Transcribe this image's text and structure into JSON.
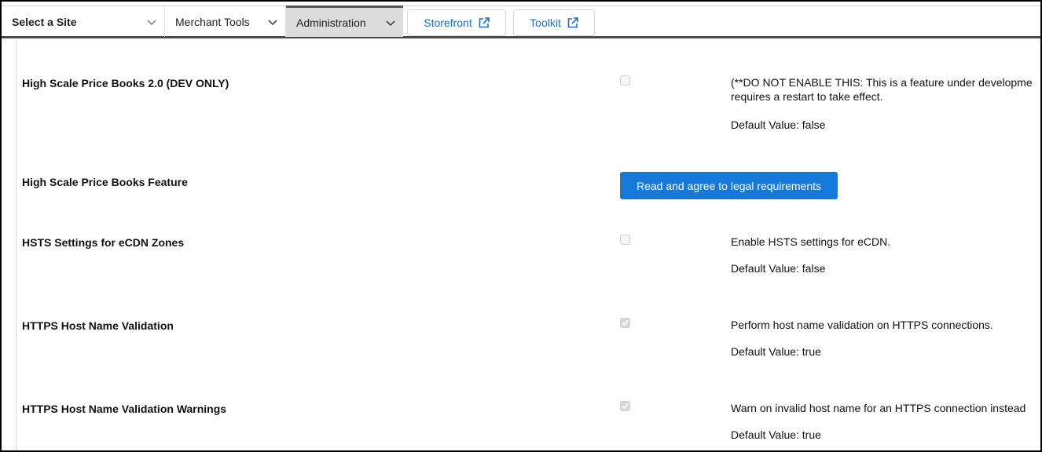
{
  "nav": {
    "site_select": {
      "label": "Select a Site",
      "icon": "chevron-down-icon"
    },
    "merchant_tools": {
      "label": "Merchant Tools",
      "icon": "chevron-down-icon"
    },
    "administration": {
      "label": "Administration",
      "icon": "chevron-down-icon",
      "active": true
    },
    "storefront": {
      "label": "Storefront",
      "icon": "external-link-icon"
    },
    "toolkit": {
      "label": "Toolkit",
      "icon": "external-link-icon"
    }
  },
  "colors": {
    "link": "#1a6fc8",
    "primary_button": "#1479d8",
    "active_tab_bg": "#dcdcdc",
    "nav_border": "#4a4a4a"
  },
  "preferences": [
    {
      "name": "High Scale Price Books 2.0 (DEV ONLY)",
      "control": "checkbox",
      "checked": false,
      "description_lines": [
        "(**DO NOT ENABLE THIS: This is a feature under developme",
        "requires a restart to take effect."
      ],
      "default_value": "Default Value: false"
    },
    {
      "name": "High Scale Price Books Feature",
      "control": "button",
      "button_label": "Read and agree to legal requirements"
    },
    {
      "name": "HSTS Settings for eCDN Zones",
      "control": "checkbox",
      "checked": false,
      "description_lines": [
        "Enable HSTS settings for eCDN."
      ],
      "default_value": "Default Value: false"
    },
    {
      "name": "HTTPS Host Name Validation",
      "control": "checkbox",
      "checked": true,
      "description_lines": [
        "Perform host name validation on HTTPS connections."
      ],
      "default_value": "Default Value: true"
    },
    {
      "name": "HTTPS Host Name Validation Warnings",
      "control": "checkbox",
      "checked": true,
      "description_lines": [
        "Warn on invalid host name for an HTTPS connection instead"
      ],
      "default_value": "Default Value: true"
    }
  ]
}
